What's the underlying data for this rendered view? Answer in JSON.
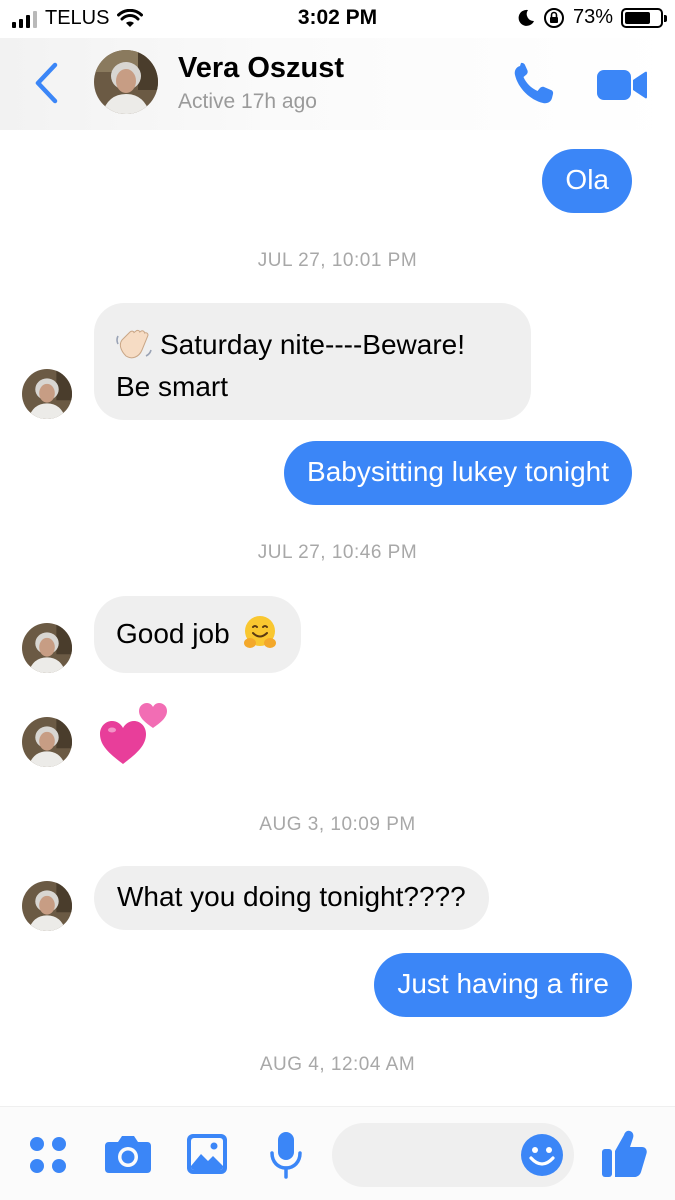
{
  "status_bar": {
    "carrier": "TELUS",
    "time": "3:02 PM",
    "battery": "73%",
    "battery_level": 0.73,
    "icons": [
      "signal-icon",
      "wifi-icon",
      "moon-icon",
      "orientation-lock-icon",
      "battery-icon"
    ]
  },
  "header": {
    "contact_name": "Vera Oszust",
    "contact_status": "Active 17h ago",
    "icons": [
      "back-chevron-icon",
      "phone-icon",
      "video-camera-icon"
    ]
  },
  "conversation": {
    "messages": [
      {
        "direction": "outgoing",
        "text": "Ola"
      },
      {
        "type": "timestamp",
        "text": "JUL 27, 10:01 PM"
      },
      {
        "direction": "incoming",
        "emoji": "waving-hand-emoji",
        "lines": [
          "Saturday nite----Beware!",
          "Be smart"
        ]
      },
      {
        "direction": "outgoing",
        "text": "Babysitting lukey tonight"
      },
      {
        "type": "timestamp",
        "text": "JUL 27, 10:46 PM"
      },
      {
        "direction": "incoming",
        "text": "Good job",
        "emoji": "hugging-face-emoji"
      },
      {
        "direction": "incoming",
        "emoji": "two-hearts-emoji"
      },
      {
        "type": "timestamp",
        "text": "AUG 3, 10:09 PM"
      },
      {
        "direction": "incoming",
        "text": "What you doing tonight????"
      },
      {
        "direction": "outgoing",
        "text": "Just having a fire"
      },
      {
        "type": "timestamp",
        "text": "AUG 4, 12:04 AM"
      }
    ]
  },
  "composer": {
    "message_placeholder": "",
    "icons": [
      "apps-grid-icon",
      "camera-icon",
      "gallery-icon",
      "microphone-icon",
      "emoji-icon",
      "thumbs-up-icon"
    ]
  },
  "colors": {
    "accent": "#3b86f7",
    "incoming_bubble": "#efefef",
    "timestamp": "#a8a8a8"
  }
}
